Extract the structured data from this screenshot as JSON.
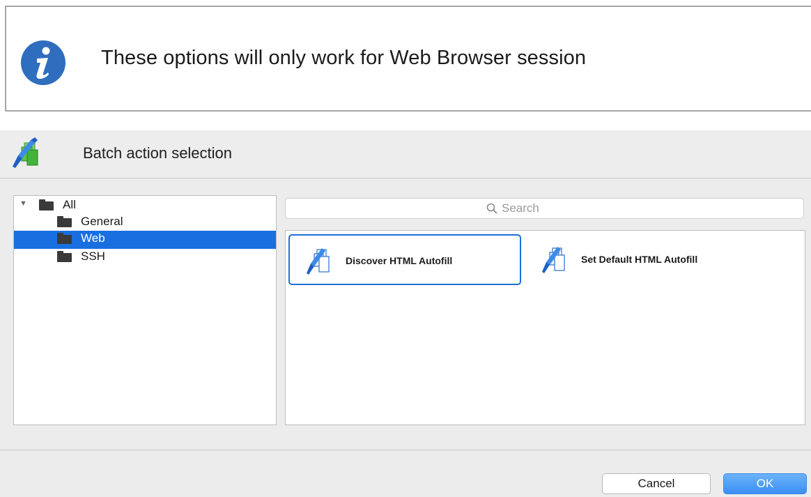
{
  "info": {
    "icon": "info-icon",
    "text": "These options will only work for Web Browser session"
  },
  "dialog": {
    "header_icon": "batch-action-icon",
    "title": "Batch action selection"
  },
  "tree": {
    "root": {
      "label": "All",
      "expanded": true
    },
    "items": [
      {
        "label": "General",
        "selected": false
      },
      {
        "label": "Web",
        "selected": true
      },
      {
        "label": "SSH",
        "selected": false
      }
    ]
  },
  "search": {
    "placeholder": "Search"
  },
  "actions": [
    {
      "label": "Discover HTML Autofill",
      "icon": "autofill-action-icon",
      "selected": true
    },
    {
      "label": "Set Default HTML Autofill",
      "icon": "autofill-action-icon",
      "selected": false
    }
  ],
  "buttons": {
    "cancel": "Cancel",
    "ok": "OK"
  },
  "colors": {
    "accent": "#1a6fe0",
    "info_blue": "#2f6dbe",
    "ok_button": "#3b8ff5"
  }
}
